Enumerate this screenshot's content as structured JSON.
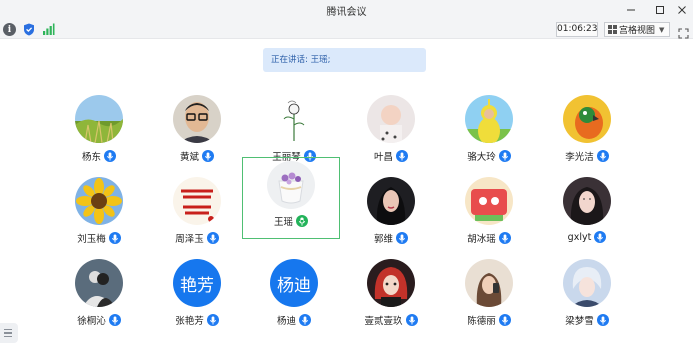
{
  "window": {
    "title": "腾讯会议"
  },
  "toolbar": {
    "timer": "01:06:23",
    "view_mode": "宫格视图"
  },
  "banner": {
    "speaking_text": "正在讲话: 王瑶;"
  },
  "participants": [
    {
      "name": "杨东",
      "avatar": "grassland-photo",
      "mic": "on",
      "active": false
    },
    {
      "name": "黄斌",
      "avatar": "man-with-glasses-photo",
      "mic": "on",
      "active": false
    },
    {
      "name": "王丽琴",
      "avatar": "flower-sketch",
      "mic": "on",
      "active": false
    },
    {
      "name": "叶昌",
      "avatar": "baby-photo",
      "mic": "on",
      "active": false
    },
    {
      "name": "骆大玲",
      "avatar": "teletubby-photo",
      "mic": "on",
      "active": false
    },
    {
      "name": "李光洁",
      "avatar": "parrot-photo",
      "mic": "on",
      "active": false
    },
    {
      "name": "刘玉梅",
      "avatar": "sunflower-photo",
      "mic": "on",
      "active": false
    },
    {
      "name": "周泽玉",
      "avatar": "calligraphy-image",
      "mic": "on",
      "active": false
    },
    {
      "name": "王瑶",
      "avatar": "flower-teacup-photo",
      "mic": "speaking",
      "active": true
    },
    {
      "name": "郭维",
      "avatar": "woman-portrait-photo",
      "mic": "on",
      "active": false
    },
    {
      "name": "胡冰瑶",
      "avatar": "cartoon-photo",
      "mic": "on",
      "active": false
    },
    {
      "name": "gxlyt",
      "avatar": "girl-portrait-photo",
      "mic": "on",
      "active": false
    },
    {
      "name": "徐桐沁",
      "avatar": "couple-illustration",
      "mic": "on",
      "active": false
    },
    {
      "name": "张艳芳",
      "avatar": "text-avatar",
      "avatar_text": "艳芳",
      "mic": "on",
      "active": false
    },
    {
      "name": "杨迪",
      "avatar": "text-avatar",
      "avatar_text": "杨迪",
      "mic": "on",
      "active": false
    },
    {
      "name": "壹贰壹玖",
      "avatar": "red-hair-girl-illustration",
      "mic": "on",
      "active": false
    },
    {
      "name": "陈德丽",
      "avatar": "girl-with-phone-photo",
      "mic": "on",
      "active": false
    },
    {
      "name": "梁梦雪",
      "avatar": "anime-boy-illustration",
      "mic": "on",
      "active": false
    }
  ],
  "colors": {
    "accent": "#1677ee",
    "speaking": "#23b35a",
    "active_border": "#4fbf73",
    "banner_bg": "#dbe9fb"
  }
}
